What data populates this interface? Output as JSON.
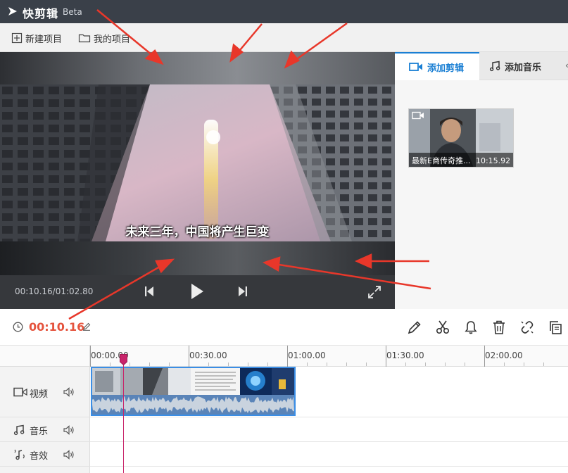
{
  "app": {
    "title": "快剪辑",
    "badge": "Beta"
  },
  "toolbar": {
    "new_project": "新建项目",
    "my_projects": "我的项目"
  },
  "preview": {
    "subtitle": "未来三年，中国将产生巨变",
    "time_readout": "00:10.16/01:02.80"
  },
  "side": {
    "tabs": [
      {
        "label": "添加剪辑"
      },
      {
        "label": "添加音乐"
      }
    ],
    "more": "‹",
    "clip": {
      "title": "最新E商传奇推...",
      "duration": "10:15.92"
    }
  },
  "timeline": {
    "current_time": "00:10.16",
    "ruler": [
      "00:00.00",
      "00:30.00",
      "01:00.00",
      "01:30.00",
      "02:00.00"
    ],
    "tracks": [
      {
        "label": "视频"
      },
      {
        "label": "音乐"
      },
      {
        "label": "音效"
      }
    ]
  },
  "colors": {
    "accent": "#1a7fd4",
    "time_red": "#e5533d",
    "playhead": "#c8246a",
    "arrow": "#e8372a"
  }
}
